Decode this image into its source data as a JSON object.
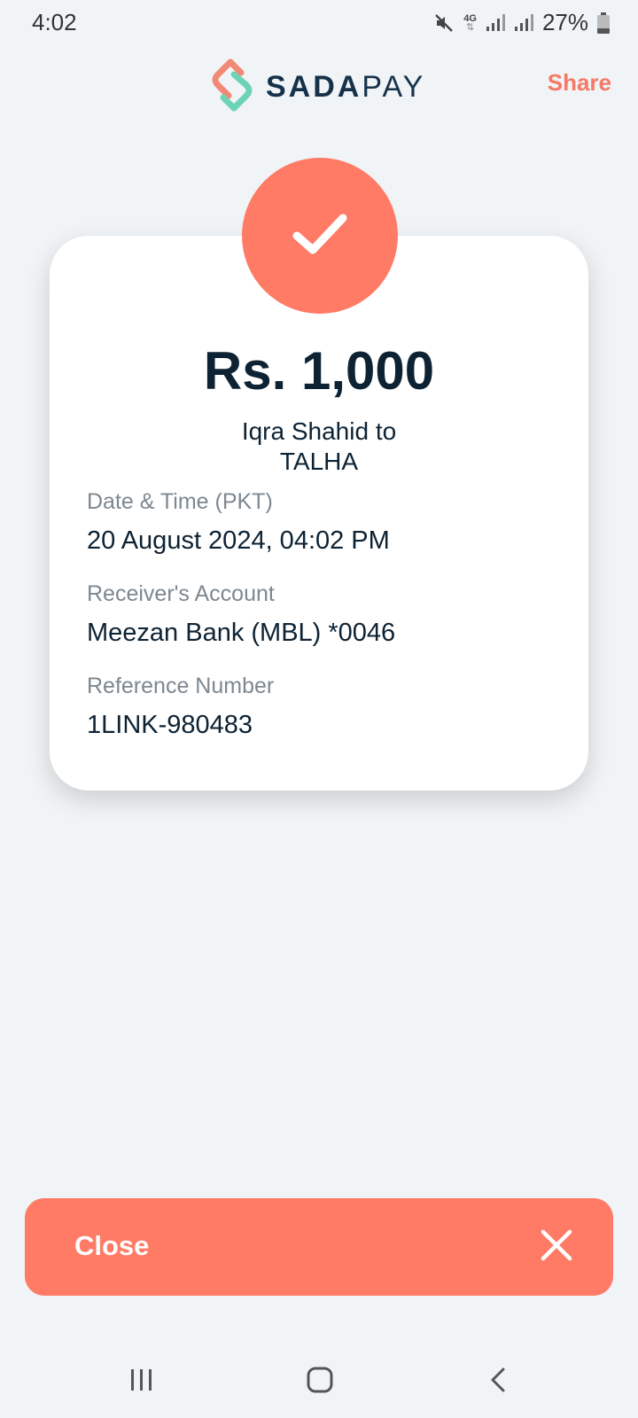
{
  "status_bar": {
    "time": "4:02",
    "battery": "27%",
    "network": "4G",
    "icons": [
      "mute-icon",
      "network-4g-icon",
      "signal-icon",
      "signal-icon",
      "battery-icon"
    ]
  },
  "header": {
    "brand_bold": "SADA",
    "brand_light": "PAY",
    "share_label": "Share"
  },
  "receipt": {
    "amount": "Rs. 1,000",
    "parties_line1": "Iqra Shahid to",
    "parties_line2": "TALHA",
    "fields": [
      {
        "label": "Date & Time (PKT)",
        "value": "20 August 2024, 04:02 PM"
      },
      {
        "label": "Receiver's Account",
        "value": "Meezan Bank (MBL) *0046"
      },
      {
        "label": "Reference Number",
        "value": "1LINK-980483"
      }
    ]
  },
  "footer": {
    "close_label": "Close"
  },
  "colors": {
    "accent": "#ff7b66",
    "background": "#f1f4f6",
    "text": "#0d2233",
    "muted": "#7d8891"
  }
}
